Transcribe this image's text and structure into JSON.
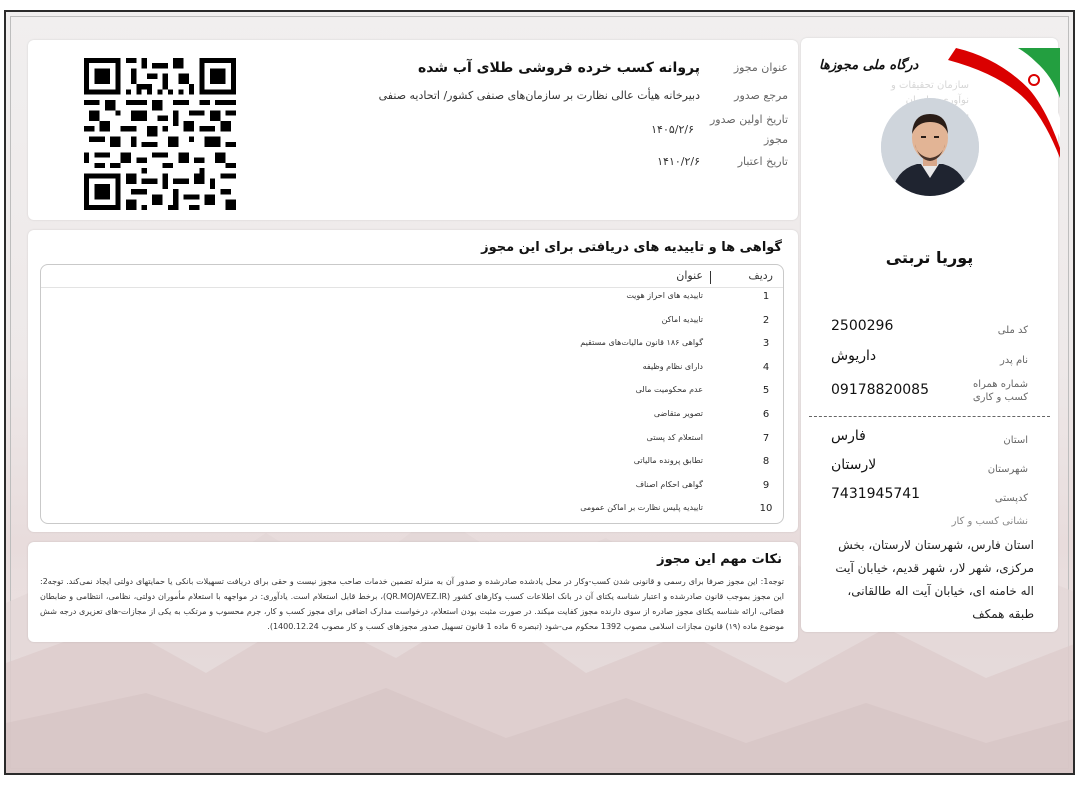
{
  "license": {
    "title_label": "عنوان مجوز",
    "title": "پروانه کسب خرده فروشی طلای آب شده",
    "issuer_label": "مرجع صدور",
    "issuer": "دبیرخانه هیأت عالی نظارت بر سازمان‌های صنفی کشور/ اتحادیه صنفی",
    "first_issue_label": "تاریخ اولین صدور مجوز",
    "first_issue": "۱۴۰۵/۲/۶",
    "validity_label": "تاریخ اعتبار",
    "validity": "۱۴۱۰/۲/۶"
  },
  "certificates": {
    "title": "گواهی ها و تاییدیه های دریافتی برای این مجوز",
    "col_row": "ردیف",
    "col_title": "عنوان",
    "rows": [
      {
        "num": "1",
        "title": "تاییدیه های احراز هویت"
      },
      {
        "num": "2",
        "title": "تاییدیه اماکن"
      },
      {
        "num": "3",
        "title": "گواهی ۱۸۶ قانون مالیات‌های مستقیم"
      },
      {
        "num": "4",
        "title": "دارای نظام وظیفه"
      },
      {
        "num": "5",
        "title": "عدم محکومیت مالی"
      },
      {
        "num": "6",
        "title": "تصویر متقاضی"
      },
      {
        "num": "7",
        "title": "استعلام کد پستی"
      },
      {
        "num": "8",
        "title": "تطابق پرونده مالیاتی"
      },
      {
        "num": "9",
        "title": "گواهی احکام اصناف"
      },
      {
        "num": "10",
        "title": "تاییدیه پلیس نظارت بر اماکن عمومی"
      }
    ]
  },
  "notes": {
    "title": "نکات مهم این مجوز",
    "text": "توجه1: این مجوز صرفا برای رسمی و قانونی شدن کسب-وکار در محل یادشده صادرشده و صدور آن به منزله تضمین خدمات صاحب مجوز نیست و حقی برای دریافت تسهیلات بانکی یا حمایتهای دولتی ایجاد نمی‌کند. توجه2: این مجوز بموجب قانون صادرشده و اعتبار شناسه یکتای آن در بانک اطلاعات کسب وکارهای کشور (QR.MOJAVEZ.IR)، برخط قابل استعلام است. یادآوری: در مواجهه با استعلام مأموران دولتی، نظامی، انتظامی و ضابطان قضائی، ارائه شناسه یکتای مجوز صادره از سوی دارنده مجوز کفایت میکند. در صورت مثبت بودن استعلام، درخواست مدارک اضافی برای مجوز کسب و کار، جرم محسوب و مرتکب به یکی از مجازات-های تعزیری درجه شش موضوع ماده (۱۹) قانون مجازات اسلامی مصوب 1392 محکوم می-شود (تبصره 6 ماده 1 قانون تسهیل صدور مجوزهای کسب و کار مصوب 1400.12.24)."
  },
  "profile": {
    "logo": "درگاه ملی مجوزها",
    "bg_text": "سازمان تحقیقات و نوآوری سازمان سازمان",
    "name": "پوریا تربتی",
    "national_id_label": "کد ملی",
    "national_id": "2500296",
    "father_label": "نام پدر",
    "father": "داریوش",
    "mobile_label": "شماره همراه کسب و کاری",
    "mobile": "09178820085",
    "province_label": "استان",
    "province": "فارس",
    "city_label": "شهرستان",
    "city": "لارستان",
    "postal_label": "کدپستی",
    "postal": "7431945741",
    "address_label": "نشانی کسب و کار",
    "address": "استان فارس، شهرستان لارستان، بخش مرکزی، شهر لار، شهر قدیم، خیابان آیت اله خامنه ای، خیابان آیت اله طالقانی، طبقه همکف"
  },
  "colors": {
    "flag_green": "#239f40",
    "flag_red": "#da0000",
    "frame_border": "#2b2b2b"
  }
}
